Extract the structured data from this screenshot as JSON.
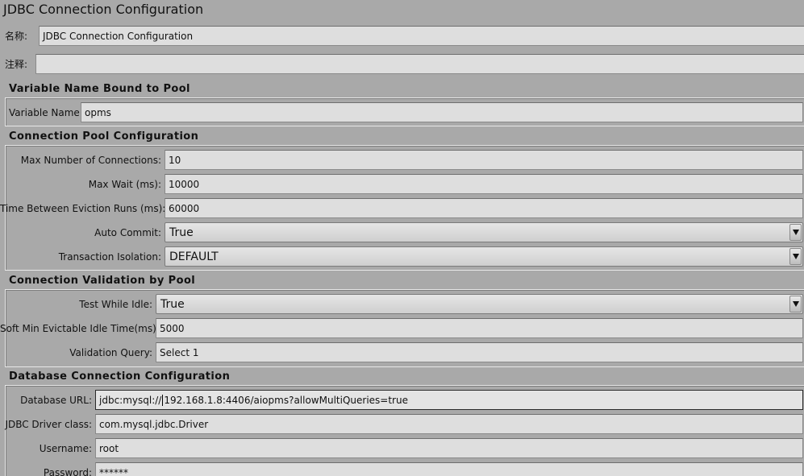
{
  "window": {
    "title": "JDBC Connection Configuration"
  },
  "name_row": {
    "label": "名称:",
    "value": "JDBC Connection Configuration"
  },
  "comment_row": {
    "label": "注释:",
    "value": ""
  },
  "variable_section": {
    "title": "Variable Name Bound to Pool",
    "label": "Variable Name:",
    "value": "opms"
  },
  "pool_section": {
    "title": "Connection Pool Configuration",
    "max_connections": {
      "label": "Max Number of Connections:",
      "value": "10"
    },
    "max_wait": {
      "label": "Max Wait (ms):",
      "value": "10000"
    },
    "eviction": {
      "label": "Time Between Eviction Runs (ms):",
      "value": "60000"
    },
    "auto_commit": {
      "label": "Auto Commit:",
      "value": "True"
    },
    "isolation": {
      "label": "Transaction Isolation:",
      "value": "DEFAULT"
    }
  },
  "validation_section": {
    "title": "Connection Validation by Pool",
    "test_idle": {
      "label": "Test While Idle:",
      "value": "True"
    },
    "soft_min": {
      "label": "Soft Min Evictable Idle Time(ms):",
      "value": "5000"
    },
    "query": {
      "label": "Validation Query:",
      "value": "Select 1"
    }
  },
  "db_section": {
    "title": "Database Connection Configuration",
    "url": {
      "label": "Database URL:",
      "value_before_caret": "jdbc:mysql://",
      "value_after_caret": "192.168.1.8:4406/aiopms?allowMultiQueries=true"
    },
    "driver": {
      "label": "JDBC Driver class:",
      "value": "com.mysql.jdbc.Driver"
    },
    "username": {
      "label": "Username:",
      "value": "root"
    },
    "password": {
      "label": "Password:",
      "value": "******"
    }
  }
}
